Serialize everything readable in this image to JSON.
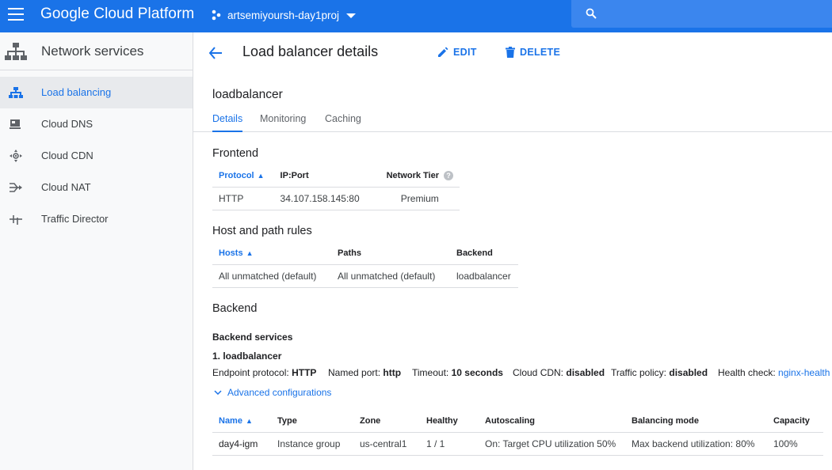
{
  "topbar": {
    "brand": "Google Cloud Platform",
    "project_name": "artsemiyoursh-day1proj",
    "search_placeholder": "",
    "icons": [
      "menu-icon",
      "project-icon",
      "dropdown-caret-icon",
      "search-icon"
    ]
  },
  "sidebar": {
    "title": "Network services",
    "items": [
      {
        "label": "Load balancing",
        "icon": "load-balancing-icon",
        "active": true
      },
      {
        "label": "Cloud DNS",
        "icon": "cloud-dns-icon",
        "active": false
      },
      {
        "label": "Cloud CDN",
        "icon": "cloud-cdn-icon",
        "active": false
      },
      {
        "label": "Cloud NAT",
        "icon": "cloud-nat-icon",
        "active": false
      },
      {
        "label": "Traffic Director",
        "icon": "traffic-director-icon",
        "active": false
      }
    ]
  },
  "header": {
    "title": "Load balancer details",
    "edit_label": "EDIT",
    "delete_label": "DELETE"
  },
  "lb": {
    "name": "loadbalancer",
    "tabs": [
      "Details",
      "Monitoring",
      "Caching"
    ],
    "active_tab": "Details"
  },
  "frontend": {
    "title": "Frontend",
    "columns": [
      "Protocol",
      "IP:Port",
      "Network Tier"
    ],
    "rows": [
      [
        "HTTP",
        "34.107.158.145:80",
        "Premium"
      ]
    ]
  },
  "host_rules": {
    "title": "Host and path rules",
    "columns": [
      "Hosts",
      "Paths",
      "Backend"
    ],
    "rows": [
      [
        "All unmatched (default)",
        "All unmatched (default)",
        "loadbalancer"
      ]
    ]
  },
  "backend": {
    "title": "Backend",
    "services_title": "Backend services",
    "service_name": "1. loadbalancer",
    "endpoint_protocol_label": "Endpoint protocol:",
    "endpoint_protocol": "HTTP",
    "named_port_label": "Named port:",
    "named_port": "http",
    "timeout_label": "Timeout:",
    "timeout": "10 seconds",
    "cdn_label": "Cloud CDN:",
    "cdn": "disabled",
    "traffic_policy_label": "Traffic policy:",
    "traffic_policy": "disabled",
    "health_check_label": "Health check:",
    "health_check": "nginx-health",
    "advanced_label": "Advanced configurations",
    "columns": [
      "Name",
      "Type",
      "Zone",
      "Healthy",
      "Autoscaling",
      "Balancing mode",
      "Capacity"
    ],
    "rows": [
      [
        "day4-igm",
        "Instance group",
        "us-central1",
        "1 / 1",
        "On: Target CPU utilization 50%",
        "Max backend utilization: 80%",
        "100%"
      ]
    ]
  },
  "colors": {
    "primary": "#1a73e8",
    "sidebar_bg": "#f8f9fa",
    "sidebar_active": "#e8eaed"
  }
}
